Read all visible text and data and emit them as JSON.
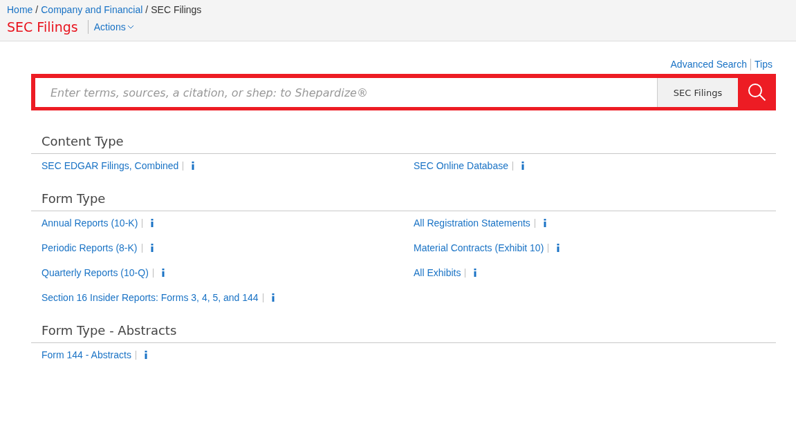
{
  "breadcrumb_separator": "/",
  "breadcrumb": [
    {
      "label": "Home",
      "link": true
    },
    {
      "label": "Company and Financial",
      "link": true
    },
    {
      "label": "SEC Filings",
      "link": false
    }
  ],
  "page_title": "SEC Filings",
  "actions_menu": {
    "label": "Actions"
  },
  "search_links": [
    "Advanced Search",
    "Tips"
  ],
  "search": {
    "placeholder": "Enter terms, sources, a citation, or shep: to Shepardize®",
    "scope": "SEC Filings"
  },
  "sections": [
    {
      "title": "Content Type",
      "items": [
        "SEC EDGAR Filings, Combined",
        "SEC Online Database"
      ]
    },
    {
      "title": "Form Type",
      "items": [
        "Annual Reports (10-K)",
        "All Registration Statements",
        "Periodic Reports (8-K)",
        "Material Contracts (Exhibit 10)",
        "Quarterly Reports (10-Q)",
        "All Exhibits",
        "Section 16 Insider Reports: Forms 3, 4, 5, and 144"
      ]
    },
    {
      "title": "Form Type - Abstracts",
      "items": [
        "Form 144 - Abstracts"
      ]
    }
  ]
}
